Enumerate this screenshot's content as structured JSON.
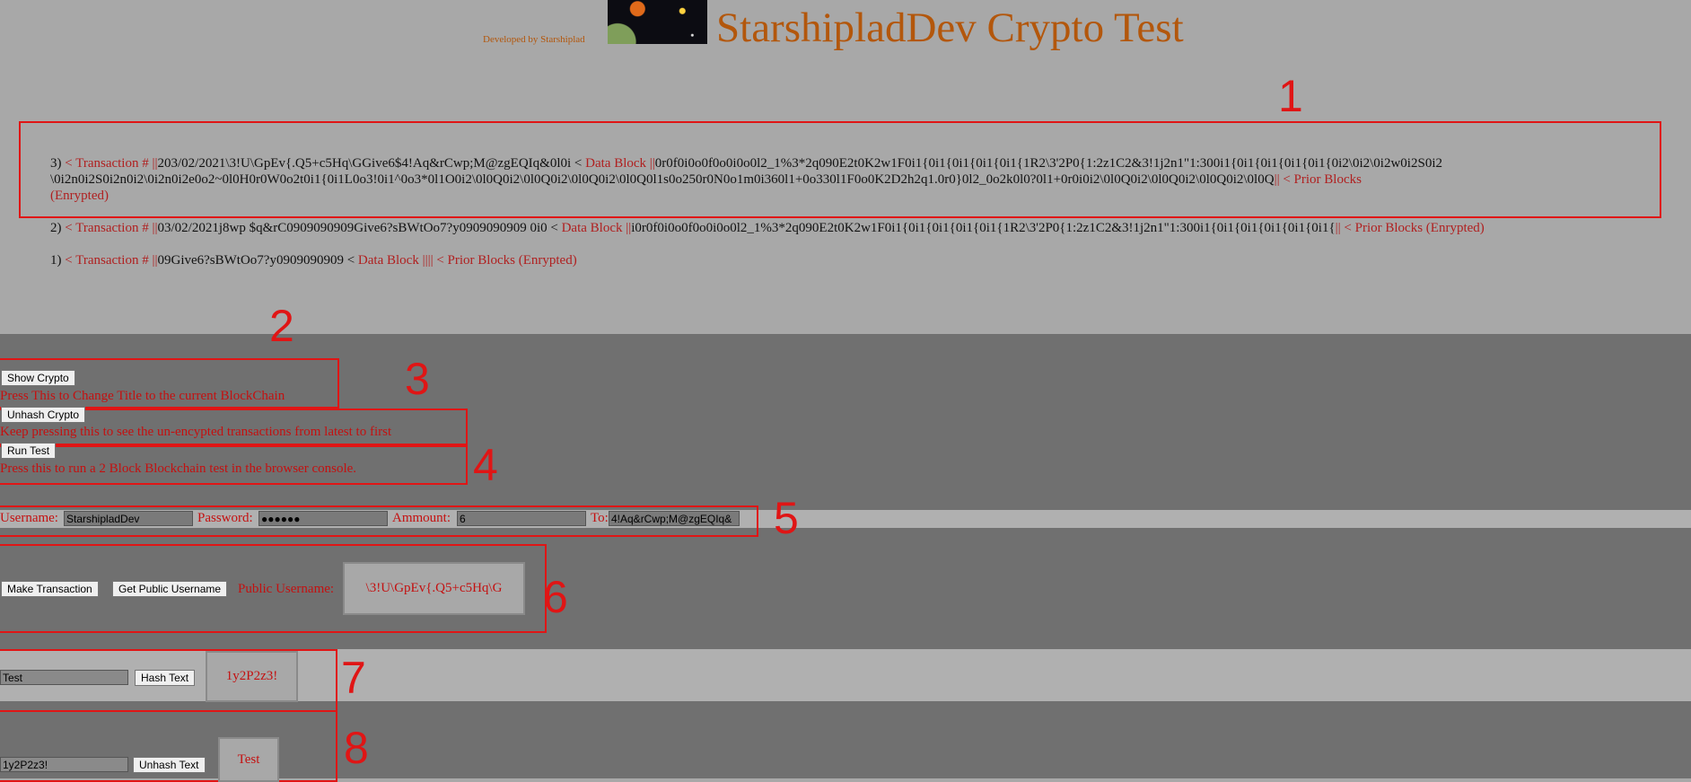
{
  "header": {
    "credit": "Developed by Starshiplad",
    "title": "StarshipladDev Crypto Test"
  },
  "annotations": [
    "1",
    "2",
    "3",
    "4",
    "5",
    "6",
    "7",
    "8"
  ],
  "blocks": [
    {
      "index": "3)",
      "tx_label": "< Transaction # ||",
      "tx_value": "203/02/2021\\3!U\\GpEv{.Q5+c5Hq\\GGive6$4!Aq&rCwp;M@zgEQIq&0l0i <",
      "data_label": "Data Block ||",
      "data_value_1": "0r0f0i0o0f0o0i0o0l2_1%3*2q090E2t0K2w1F0i1{0i1{0i1{0i1{0i1{1R2\\3'2P0{1:2z1C2&3!1j2n1\"1:300i1{0i1{0i1{0i1{0i1{0i2\\0i2\\0i2w0i2S0i2",
      "data_value_2": "\\0i2n0i2S0i2n0i2\\0i2n0i2e0o2~0l0H0r0W0o2t0i1{0i1L0o3!0i1^0o3*0l1O0i2\\0l0Q0i2\\0l0Q0i2\\0l0Q0i2\\0l0Q0l1s0o250r0N0o1m0i360l1+0o330l1F0o0K2D2h2q1.0r0}0l2_0o2k0l0?0l1+0r0i0i2\\0l0Q0i2\\0l0Q0i2\\0l0Q0i2\\0l0Q",
      "prior_label": "|| < Prior Blocks",
      "prior_label_2": "(Enrypted)"
    },
    {
      "index": "2)",
      "tx_label": "< Transaction # ||",
      "tx_value": "03/02/2021j8wp $q&rC0909090909Give6?sBWtOo7?y0909090909 0i0 <",
      "data_label": "Data Block ||",
      "data_value_1": "i0r0f0i0o0f0o0i0o0l2_1%3*2q090E2t0K2w1F0i1{0i1{0i1{0i1{0i1{1R2\\3'2P0{1:2z1C2&3!1j2n1\"1:300i1{0i1{0i1{0i1{0i1{0i1{",
      "prior_label": "|| < Prior Blocks (Enrypted)"
    },
    {
      "index": "1)",
      "tx_label": "< Transaction # ||",
      "tx_value": "09Give6?sBWtOo7?y0909090909 <",
      "data_label": "Data Block ||||",
      "prior_label": "< Prior Blocks (Enrypted)"
    }
  ],
  "controls": {
    "show_crypto": "Show Crypto",
    "show_crypto_hint": "Press This to Change Title to the current BlockChain",
    "unhash_crypto": "Unhash Crypto",
    "unhash_crypto_hint": "Keep pressing this to see the un-encypted transactions from latest to first",
    "run_test": "Run Test",
    "run_test_hint": "Press this to run a 2 Block Blockchain test in the browser console."
  },
  "form": {
    "username_label": "Username:",
    "username_value": "StarshipladDev",
    "password_label": "Password:",
    "password_value": "●●●●●●",
    "amount_label": "Ammount:",
    "amount_value": "6",
    "to_label": "To:",
    "to_value": "4!Aq&rCwp;M@zgEQIq&"
  },
  "transaction": {
    "make_transaction": "Make Transaction",
    "get_public_username": "Get Public Username",
    "public_username_label": "Public Username:",
    "public_username_value": "\\3!U\\GpEv{.Q5+c5Hq\\G"
  },
  "hash": {
    "input_value": "Test",
    "button": "Hash Text",
    "output": "1y2P2z3!"
  },
  "unhash": {
    "input_value": "1y2P2z3!",
    "button": "Unhash Text",
    "output": "Test"
  },
  "colors": {
    "accent_orange": "#b3570c",
    "highlight_red": "#e01515",
    "text_red": "#c41010",
    "bg_light": "#a8a8a8",
    "bg_dark": "#707070"
  }
}
